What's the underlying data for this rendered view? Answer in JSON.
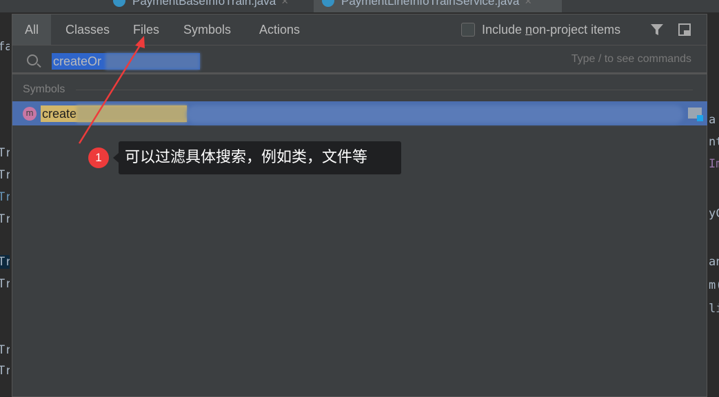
{
  "editor_tabs": [
    {
      "label": "PaymentBaseInfoTrain.java"
    },
    {
      "label": "PaymentLineInfoTrainService.java"
    }
  ],
  "background_fragments": {
    "left": [
      "fac",
      "Tra",
      "Tra",
      "Tra",
      "Tra",
      "Tra",
      "Tra",
      "Tra",
      "Tra"
    ],
    "right": [
      "a",
      "nt",
      "Im",
      "yC",
      "an",
      "m(",
      "li"
    ]
  },
  "popup": {
    "tabs": [
      {
        "label": "All",
        "selected": true
      },
      {
        "label": "Classes"
      },
      {
        "label": "Files"
      },
      {
        "label": "Symbols"
      },
      {
        "label": "Actions"
      }
    ],
    "include_checkbox": {
      "pre": "Include ",
      "mnemonic": "n",
      "post": "on-project items",
      "checked": false
    },
    "search": {
      "value": "createOr",
      "hint": "Type / to see commands"
    },
    "section": "Symbols",
    "results": [
      {
        "icon": "m",
        "name": "create"
      }
    ]
  },
  "annotation": {
    "number": "1",
    "text": "可以过滤具体搜索，例如类，文件等",
    "color": "#ee3b3b"
  }
}
